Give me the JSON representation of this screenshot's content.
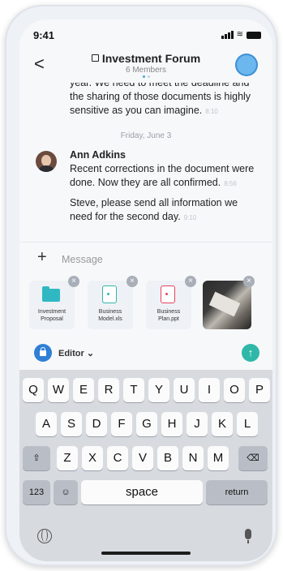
{
  "status_bar": {
    "time": "9:41"
  },
  "header": {
    "title": "Investment Forum",
    "subtitle": "6 Members"
  },
  "messages": {
    "partial_text": "year. We need to meet the deadline and the sharing of those documents is highly sensitive as you can imagine.",
    "partial_time": "8:10",
    "date_separator": "Friday, June 3",
    "sender": "Ann Adkins",
    "message_1": "Recent corrections in the document were done. Now they are all confirmed.",
    "message_1_time": "8:56",
    "message_2": "Steve, please send all information we need for the second day.",
    "message_2_time": "9:10"
  },
  "composer": {
    "placeholder": "Message"
  },
  "attachments": [
    {
      "name": "Investment Proposal",
      "type": "folder",
      "color": "#2fb8c2"
    },
    {
      "name": "Business Model.xls",
      "type": "spreadsheet",
      "color": "#2fb8a8"
    },
    {
      "name": "Business Plan.ppt",
      "type": "presentation",
      "color": "#e5445d"
    },
    {
      "name": "",
      "type": "photo"
    }
  ],
  "editor": {
    "label": "Editor"
  },
  "keyboard": {
    "row1": [
      "Q",
      "W",
      "E",
      "R",
      "T",
      "Y",
      "U",
      "I",
      "O",
      "P"
    ],
    "row2": [
      "A",
      "S",
      "D",
      "F",
      "G",
      "H",
      "J",
      "K",
      "L"
    ],
    "row3": [
      "Z",
      "X",
      "C",
      "V",
      "B",
      "N",
      "M"
    ],
    "numbers_key": "123",
    "space_key": "space",
    "return_key": "return"
  },
  "colors": {
    "accent_blue": "#2f7fd6",
    "accent_teal": "#2fb8a8"
  }
}
